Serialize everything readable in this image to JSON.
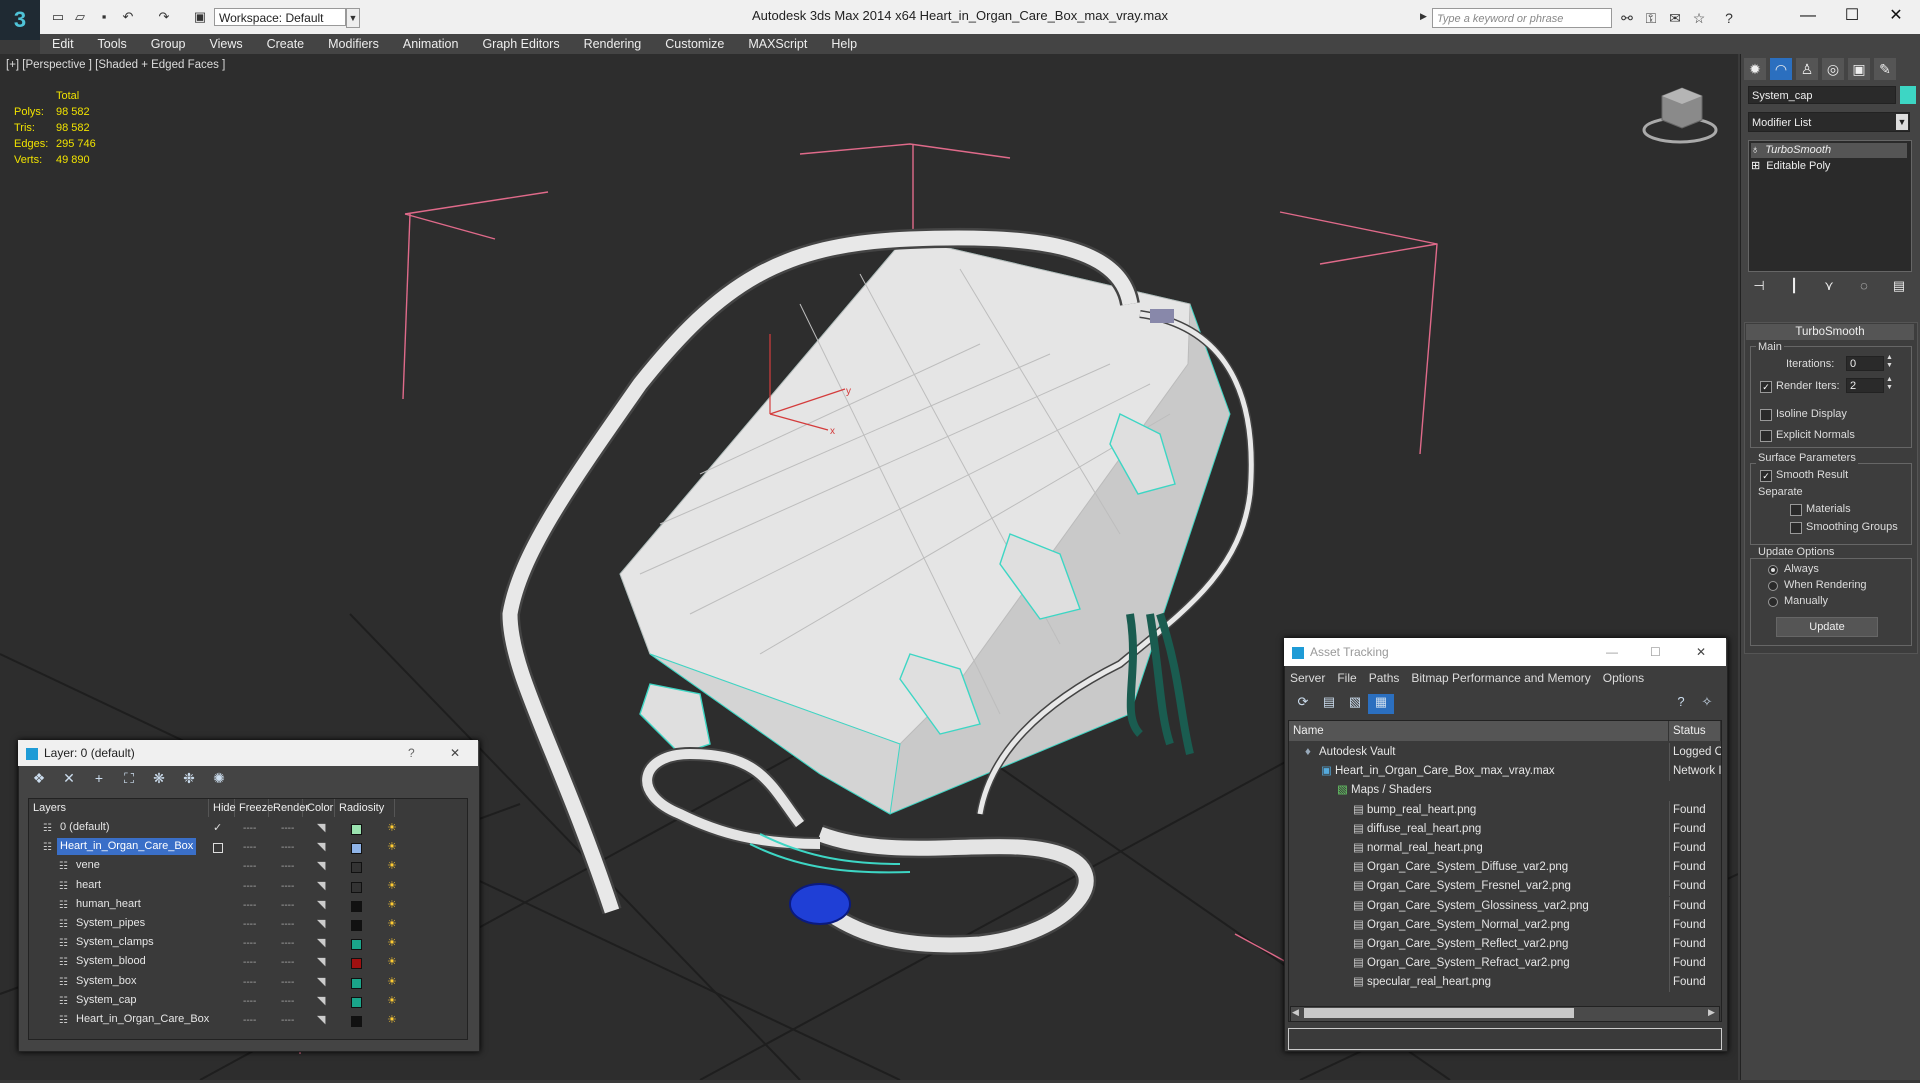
{
  "app": {
    "title": "Autodesk 3ds Max  2014 x64     Heart_in_Organ_Care_Box_max_vray.max",
    "logo": "3",
    "workspace_label": "Workspace: Default",
    "search_placeholder": "Type a keyword or phrase",
    "window_controls": [
      "—",
      "☐",
      "✕"
    ]
  },
  "menu": [
    "Edit",
    "Tools",
    "Group",
    "Views",
    "Create",
    "Modifiers",
    "Animation",
    "Graph Editors",
    "Rendering",
    "Customize",
    "MAXScript",
    "Help"
  ],
  "viewport": {
    "label": "[+] [Perspective ] [Shaded + Edged Faces ]",
    "stats": {
      "header": "Total",
      "rows": [
        {
          "k": "Polys:",
          "v": "98 582"
        },
        {
          "k": "Tris:",
          "v": "98 582"
        },
        {
          "k": "Edges:",
          "v": "295 746"
        },
        {
          "k": "Verts:",
          "v": "49 890"
        }
      ]
    },
    "axis": {
      "y": "y",
      "x": "x"
    }
  },
  "command_panel": {
    "object_name": "System_cap",
    "object_color": "#3dd6c4",
    "modifier_list": "Modifier List",
    "stack": [
      "TurboSmooth",
      "Editable Poly"
    ],
    "rollout": {
      "title": "TurboSmooth",
      "main_label": "Main",
      "iterations_label": "Iterations:",
      "iterations_value": "0",
      "render_iters_label": "Render Iters:",
      "render_iters_value": "2",
      "isoline": "Isoline Display",
      "explicit": "Explicit Normals",
      "surface_label": "Surface Parameters",
      "smooth_result": "Smooth Result",
      "separate_label": "Separate",
      "materials": "Materials",
      "smoothing_groups": "Smoothing Groups",
      "update_options": "Update Options",
      "always": "Always",
      "when_rendering": "When Rendering",
      "manually": "Manually",
      "update_button": "Update"
    }
  },
  "layer_dialog": {
    "title": "Layer: 0 (default)",
    "help": "?",
    "close": "✕",
    "columns": [
      "Layers",
      "Hide",
      "Freeze",
      "Render",
      "Color",
      "Radiosity"
    ],
    "rows": [
      {
        "name": "0 (default)",
        "color": "#9be3b0",
        "indent": 0
      },
      {
        "name": "Heart_in_Organ_Care_Box",
        "color": "#8fb4e8",
        "indent": 0,
        "selected": true
      },
      {
        "name": "vene",
        "color": "#333333",
        "indent": 1
      },
      {
        "name": "heart",
        "color": "#333333",
        "indent": 1
      },
      {
        "name": "human_heart",
        "color": "#111111",
        "indent": 1
      },
      {
        "name": "System_pipes",
        "color": "#111111",
        "indent": 1
      },
      {
        "name": "System_clamps",
        "color": "#1aa58a",
        "indent": 1
      },
      {
        "name": "System_blood",
        "color": "#a01010",
        "indent": 1
      },
      {
        "name": "System_box",
        "color": "#1aa58a",
        "indent": 1
      },
      {
        "name": "System_cap",
        "color": "#1aa58a",
        "indent": 1
      },
      {
        "name": "Heart_in_Organ_Care_Box",
        "color": "#111111",
        "indent": 1
      }
    ],
    "dash": "----",
    "check": "✓"
  },
  "asset_dialog": {
    "title": "Asset Tracking",
    "menu": [
      "Server",
      "File",
      "Paths",
      "Bitmap Performance and Memory",
      "Options"
    ],
    "columns": [
      "Name",
      "Status"
    ],
    "rows": [
      {
        "name": "Autodesk Vault",
        "status": "Logged O",
        "indent": 1,
        "icon": "vault"
      },
      {
        "name": "Heart_in_Organ_Care_Box_max_vray.max",
        "status": "Network I",
        "indent": 2,
        "icon": "max"
      },
      {
        "name": "Maps / Shaders",
        "status": "",
        "indent": 3,
        "icon": "folder"
      },
      {
        "name": "bump_real_heart.png",
        "status": "Found",
        "indent": 4,
        "icon": "file"
      },
      {
        "name": "diffuse_real_heart.png",
        "status": "Found",
        "indent": 4,
        "icon": "file"
      },
      {
        "name": "normal_real_heart.png",
        "status": "Found",
        "indent": 4,
        "icon": "file"
      },
      {
        "name": "Organ_Care_System_Diffuse_var2.png",
        "status": "Found",
        "indent": 4,
        "icon": "file"
      },
      {
        "name": "Organ_Care_System_Fresnel_var2.png",
        "status": "Found",
        "indent": 4,
        "icon": "file"
      },
      {
        "name": "Organ_Care_System_Glossiness_var2.png",
        "status": "Found",
        "indent": 4,
        "icon": "file"
      },
      {
        "name": "Organ_Care_System_Normal_var2.png",
        "status": "Found",
        "indent": 4,
        "icon": "file"
      },
      {
        "name": "Organ_Care_System_Reflect_var2.png",
        "status": "Found",
        "indent": 4,
        "icon": "file"
      },
      {
        "name": "Organ_Care_System_Refract_var2.png",
        "status": "Found",
        "indent": 4,
        "icon": "file"
      },
      {
        "name": "specular_real_heart.png",
        "status": "Found",
        "indent": 4,
        "icon": "file"
      }
    ]
  }
}
